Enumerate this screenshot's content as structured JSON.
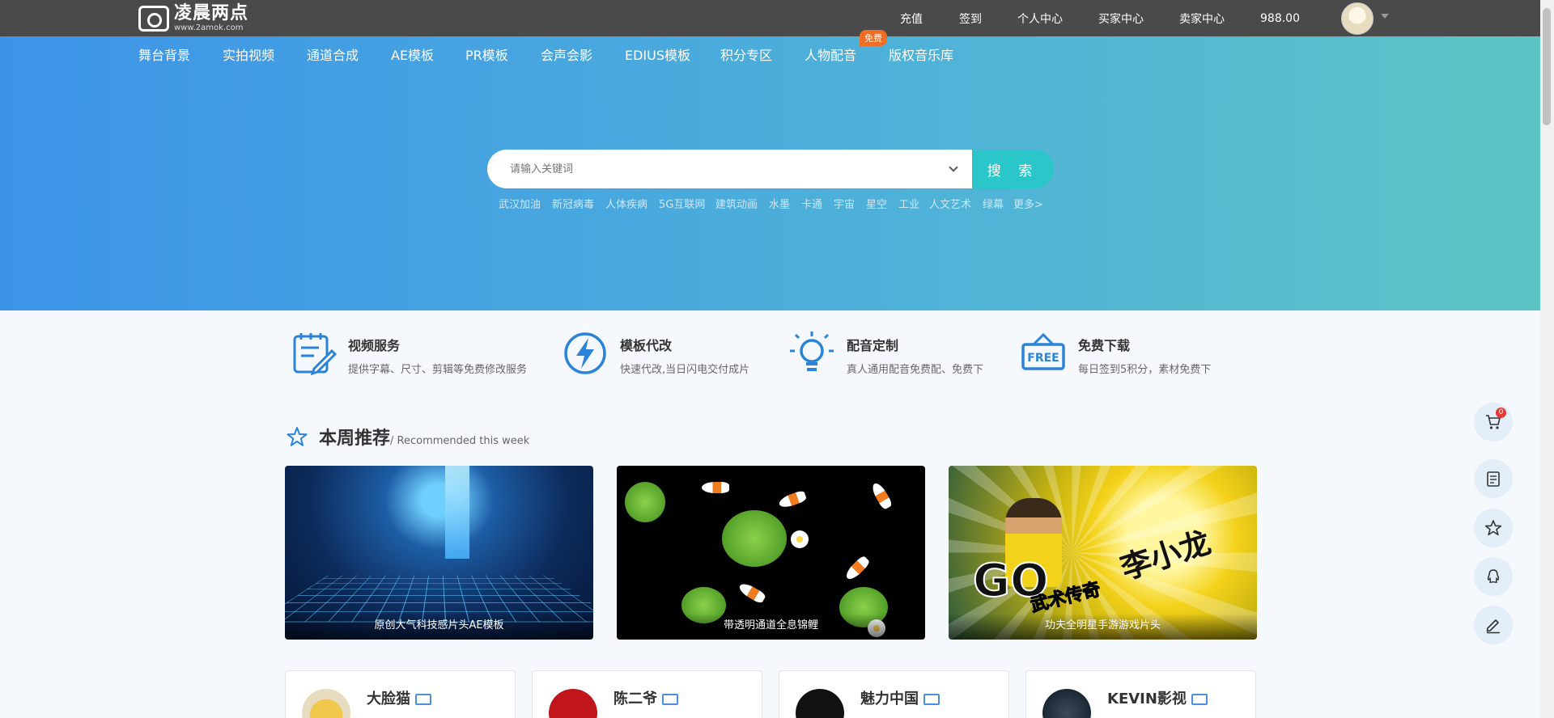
{
  "logo": {
    "name": "凌晨两点",
    "url": "www.2amok.com"
  },
  "topnav": {
    "recharge": "充值",
    "signin": "签到",
    "personal": "个人中心",
    "buyer": "买家中心",
    "seller": "卖家中心",
    "balance": "988.00"
  },
  "catnav": {
    "items": [
      "舞台背景",
      "实拍视频",
      "通道合成",
      "AE模板",
      "PR模板",
      "会声会影",
      "EDIUS模板",
      "积分专区",
      "人物配音",
      "版权音乐库"
    ],
    "badge": "免费"
  },
  "search": {
    "placeholder": "请输入关键词",
    "button": "搜 索",
    "hotwords": [
      "武汉加油",
      "新冠病毒",
      "人体疾病",
      "5G互联网",
      "建筑动画",
      "水墨",
      "卡通",
      "宇宙",
      "星空",
      "工业",
      "人文艺术",
      "绿幕",
      "更多>"
    ]
  },
  "services": [
    {
      "title": "视频服务",
      "desc": "提供字幕、尺寸、剪辑等免费修改服务",
      "icon": "clipboard-edit-icon"
    },
    {
      "title": "模板代改",
      "desc": "快速代改,当日闪电交付成片",
      "icon": "lightning-icon"
    },
    {
      "title": "配音定制",
      "desc": "真人通用配音免费配、免费下",
      "icon": "lightbulb-icon"
    },
    {
      "title": "免费下载",
      "desc": "每日签到5积分，素材免费下",
      "icon": "free-sign-icon"
    }
  ],
  "recommend": {
    "title": "本周推荐",
    "subtitle": "/ Recommended this week",
    "cards": [
      {
        "caption": "原创大气科技感片头AE模板"
      },
      {
        "caption": "带透明通道全息锦鲤"
      },
      {
        "caption": "功夫全明星手游游戏片头"
      }
    ],
    "card3_text": {
      "big": "GO",
      "cn": "李小龙",
      "cn2": "武术传奇"
    }
  },
  "authors": [
    {
      "name": "大脸猫"
    },
    {
      "name": "陈二爷"
    },
    {
      "name": "魅力中国"
    },
    {
      "name": "KEVIN影视"
    }
  ],
  "cart": {
    "count": "0"
  },
  "colors": {
    "accent": "#2bc6c9",
    "topbar": "#4a4a4a",
    "badge": "#f06d25",
    "icon_blue": "#2b84d8"
  }
}
